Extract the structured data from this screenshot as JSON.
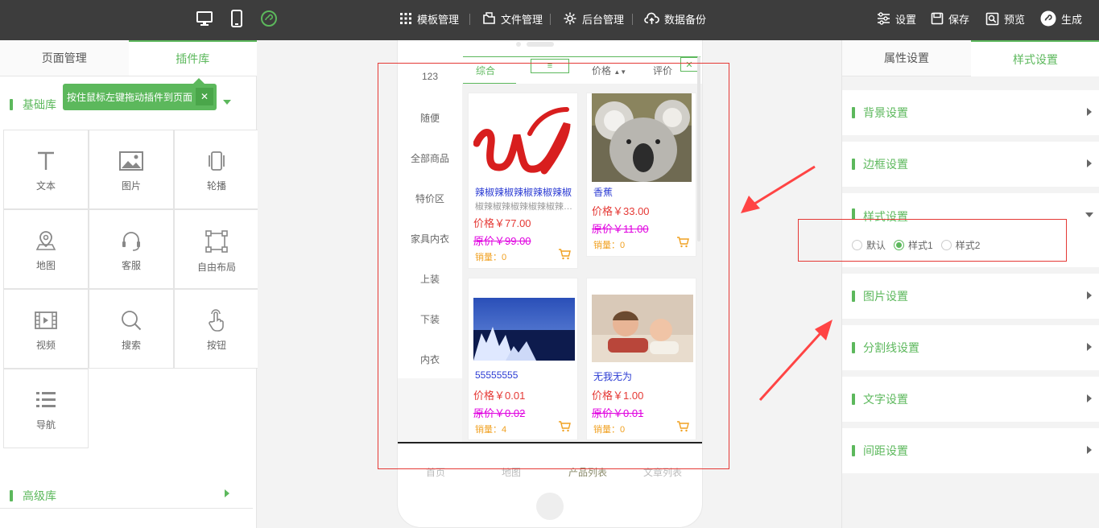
{
  "toolbar": {
    "menus": [
      "模板管理",
      "文件管理",
      "后台管理",
      "数据备份"
    ],
    "actions": [
      "设置",
      "保存",
      "预览",
      "生成"
    ]
  },
  "left": {
    "tabs": [
      "页面管理",
      "插件库"
    ],
    "basic_label": "基础库",
    "tooltip": "按住鼠标左键拖动插件到页面",
    "tooltip_close": "✕",
    "plugins": [
      "文本",
      "图片",
      "轮播",
      "地图",
      "客服",
      "自由布局",
      "视频",
      "搜索",
      "按钮",
      "导航"
    ],
    "advanced_label": "高级库"
  },
  "phone": {
    "sort_tabs": [
      "综合",
      "价格",
      "评价"
    ],
    "categories": [
      "123",
      "随便",
      "全部商品",
      "特价区",
      "家具内衣",
      "上装",
      "下装",
      "内衣"
    ],
    "products": [
      {
        "name": "辣椒辣椒辣椒辣椒辣椒",
        "desc": "椒辣椒辣椒辣椒辣椒辣椒辣椒",
        "price": "价格￥77.00",
        "orig": "原价￥99.00",
        "sales": "销量：0"
      },
      {
        "name": "香蕉",
        "desc": "",
        "price": "价格￥33.00",
        "orig": "原价￥11.00",
        "sales": "销量：0"
      },
      {
        "name": "55555555",
        "desc": "",
        "price": "价格￥0.01",
        "orig": "原价￥0.02",
        "sales": "销量：4"
      },
      {
        "name": "无我无为",
        "desc": "",
        "price": "价格￥1.00",
        "orig": "原价￥0.01",
        "sales": "销量：0"
      }
    ],
    "bottom_nav": [
      "首页",
      "地图",
      "产品列表",
      "文章列表"
    ]
  },
  "right": {
    "tabs": [
      "属性设置",
      "样式设置"
    ],
    "sections": [
      "背景设置",
      "边框设置",
      "样式设置",
      "图片设置",
      "分割线设置",
      "文字设置",
      "间距设置"
    ],
    "style_options": [
      "默认",
      "样式1",
      "样式2"
    ],
    "selected_style": "样式1"
  },
  "colors": {
    "accent": "#5cb85c",
    "topbar": "#3d3d3d",
    "annotation": "#e53935"
  }
}
